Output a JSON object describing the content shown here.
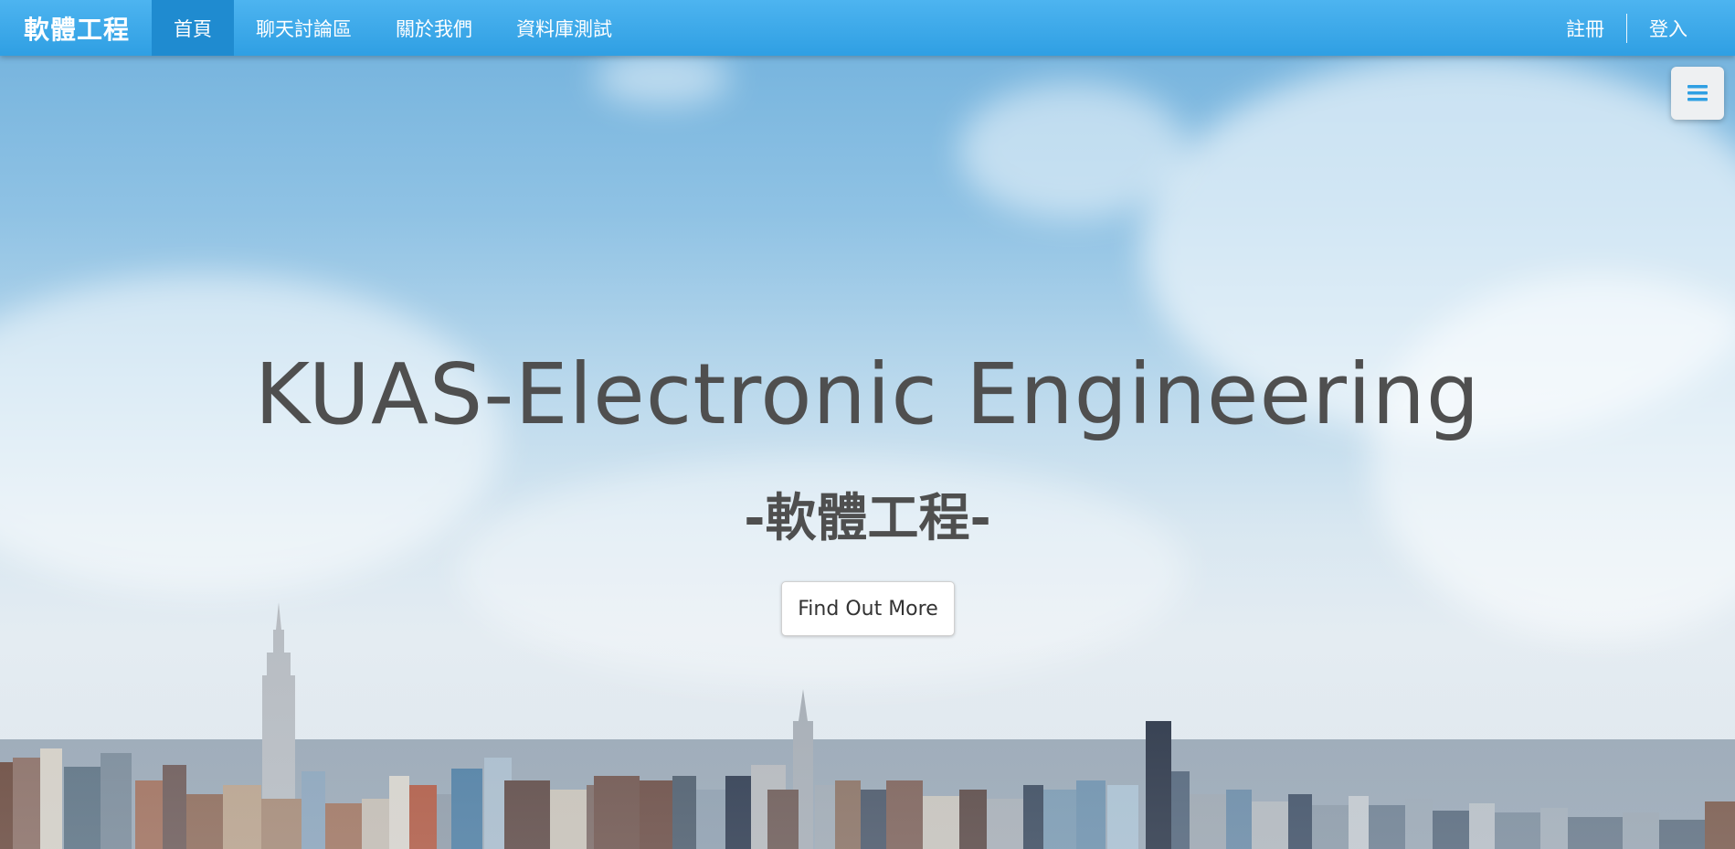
{
  "navbar": {
    "brand": "軟體工程",
    "items": [
      {
        "label": "首頁",
        "active": true
      },
      {
        "label": "聊天討論區",
        "active": false
      },
      {
        "label": "關於我們",
        "active": false
      },
      {
        "label": "資料庫測試",
        "active": false
      }
    ],
    "register": "註冊",
    "login": "登入"
  },
  "menu_toggle": {
    "icon": "hamburger-icon"
  },
  "hero": {
    "title": "KUAS-Electronic Engineering",
    "subtitle": "-軟體工程-",
    "cta_label": "Find Out More"
  },
  "colors": {
    "navbar": "#2f9fe3",
    "active_nav": "#1f8bd0",
    "text_dark": "#4f4f4f",
    "menu_icon": "#2f9fe3"
  }
}
